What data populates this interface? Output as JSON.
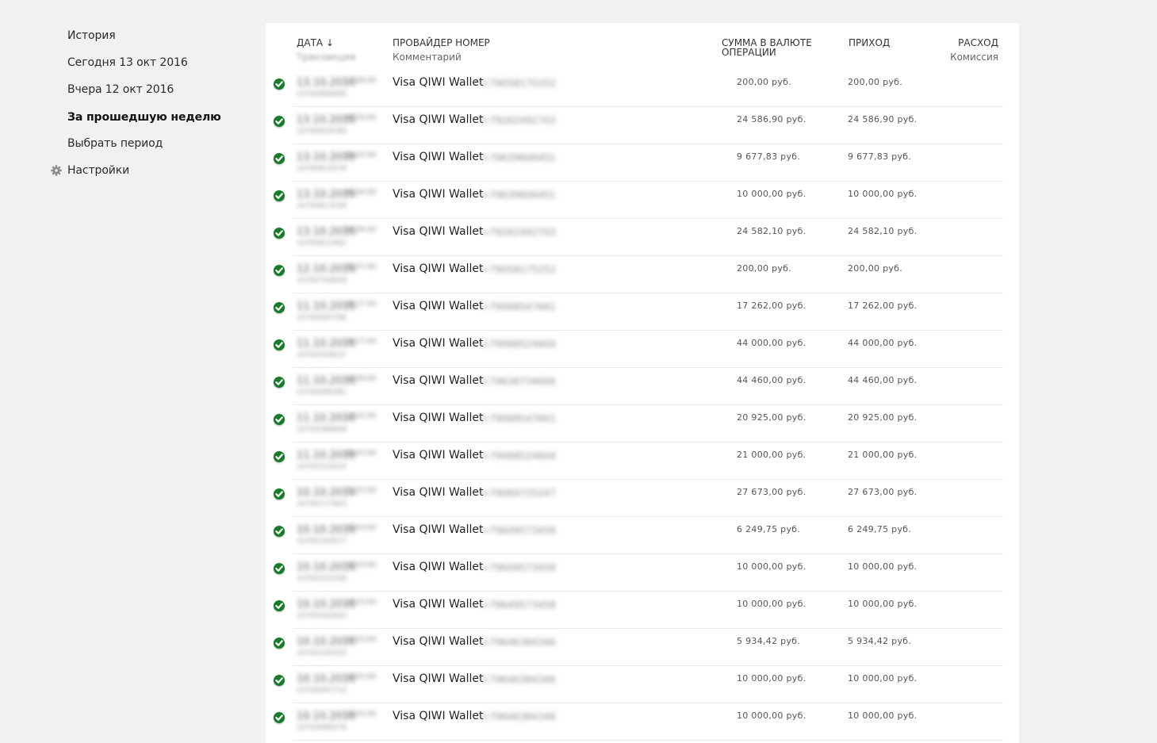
{
  "sidebar": {
    "items": [
      {
        "label": "История"
      },
      {
        "label": "Сегодня 13 окт 2016"
      },
      {
        "label": "Вчера 12 окт 2016"
      },
      {
        "label": "За прошедшую неделю",
        "active": true
      },
      {
        "label": "Выбрать период"
      },
      {
        "label": "Настройки",
        "icon": "gear-icon"
      }
    ]
  },
  "table": {
    "headers": {
      "date": "ДАТА ↓",
      "date_sub": "Транзакция",
      "provider": "ПРОВАЙДЕР НОМЕР",
      "provider_sub": "Комментарий",
      "amount_line1": "СУММА В ВАЛЮТЕ",
      "amount_line2": "ОПЕРАЦИИ",
      "income": "ПРИХОД",
      "expense": "РАСХОД",
      "expense_sub": "Комиссия"
    },
    "status_icon": "check-circle-icon",
    "status_color": "#1a7a2c",
    "rows": [
      {
        "date": "13.10.2016",
        "time": "17:08:00",
        "txn": "10700884680",
        "provider": "Visa QIWI Wallet",
        "number": "+79058175252",
        "amount": "200,00 руб.",
        "income": "200,00 руб."
      },
      {
        "date": "13.10.2016",
        "time": "09:54:00",
        "txn": "10700829789",
        "provider": "Visa QIWI Wallet",
        "number": "+79262492703",
        "amount": "24 586,90 руб.",
        "income": "24 586,90 руб."
      },
      {
        "date": "13.10.2016",
        "time": "08:02:00",
        "txn": "10700814578",
        "provider": "Visa QIWI Wallet",
        "number": "+79639606451",
        "amount": "9 677,83 руб.",
        "income": "9 677,83 руб."
      },
      {
        "date": "13.10.2016",
        "time": "00:04:00",
        "txn": "10700813228",
        "provider": "Visa QIWI Wallet",
        "number": "+79639606451",
        "amount": "10 000,00 руб.",
        "income": "10 000,00 руб."
      },
      {
        "date": "13.10.2016",
        "time": "00:04:00",
        "txn": "10700812462",
        "provider": "Visa QIWI Wallet",
        "number": "+79262492703",
        "amount": "24 582,10 руб.",
        "income": "24 582,10 руб."
      },
      {
        "date": "12.10.2016",
        "time": "20:07:00",
        "txn": "10700744628",
        "provider": "Visa QIWI Wallet",
        "number": "+79058175252",
        "amount": "200,00 руб.",
        "income": "200,00 руб."
      },
      {
        "date": "11.10.2016",
        "time": "20:17:00",
        "txn": "10700583786",
        "provider": "Visa QIWI Wallet",
        "number": "+79068547661",
        "amount": "17 262,00 руб.",
        "income": "17 262,00 руб."
      },
      {
        "date": "11.10.2016",
        "time": "18:17:00",
        "txn": "10700558437",
        "provider": "Visa QIWI Wallet",
        "number": "+79068524604",
        "amount": "44 000,00 руб.",
        "income": "44 000,00 руб."
      },
      {
        "date": "11.10.2016",
        "time": "16:09:00",
        "txn": "10700486381",
        "provider": "Visa QIWI Wallet",
        "number": "+79638734606",
        "amount": "44 460,00 руб.",
        "income": "44 460,00 руб."
      },
      {
        "date": "11.10.2016",
        "time": "12:02:00",
        "txn": "10700386848",
        "provider": "Visa QIWI Wallet",
        "number": "+79068547661",
        "amount": "20 925,00 руб.",
        "income": "20 925,00 руб."
      },
      {
        "date": "11.10.2016",
        "time": "09:03:00",
        "txn": "10700319225",
        "provider": "Visa QIWI Wallet",
        "number": "+79068524604",
        "amount": "21 000,00 руб.",
        "income": "21 000,00 руб."
      },
      {
        "date": "10.10.2016",
        "time": "21:03:00",
        "txn": "10700177803",
        "provider": "Visa QIWI Wallet",
        "number": "+79069725247",
        "amount": "27 673,00 руб.",
        "income": "27 673,00 руб."
      },
      {
        "date": "10.10.2016",
        "time": "16:03:00",
        "txn": "10700105677",
        "provider": "Visa QIWI Wallet",
        "number": "+79649573458",
        "amount": "6 249,75 руб.",
        "income": "6 249,75 руб."
      },
      {
        "date": "10.10.2016",
        "time": "16:03:00",
        "txn": "10700101038",
        "provider": "Visa QIWI Wallet",
        "number": "+79649573458",
        "amount": "10 000,00 руб.",
        "income": "10 000,00 руб."
      },
      {
        "date": "10.10.2016",
        "time": "15:03:00",
        "txn": "10700102643",
        "provider": "Visa QIWI Wallet",
        "number": "+79649573458",
        "amount": "10 000,00 руб.",
        "income": "10 000,00 руб."
      },
      {
        "date": "10.10.2016",
        "time": "15:03:00",
        "txn": "10700100253",
        "provider": "Visa QIWI Wallet",
        "number": "+79646384346",
        "amount": "5 934,42 руб.",
        "income": "5 934,42 руб."
      },
      {
        "date": "10.10.2016",
        "time": "15:03:00",
        "txn": "10700097712",
        "provider": "Visa QIWI Wallet",
        "number": "+79646384346",
        "amount": "10 000,00 руб.",
        "income": "10 000,00 руб."
      },
      {
        "date": "10.10.2016",
        "time": "15:03:00",
        "txn": "10700096276",
        "provider": "Visa QIWI Wallet",
        "number": "+79646384346",
        "amount": "10 000,00 руб.",
        "income": "10 000,00 руб."
      }
    ]
  }
}
